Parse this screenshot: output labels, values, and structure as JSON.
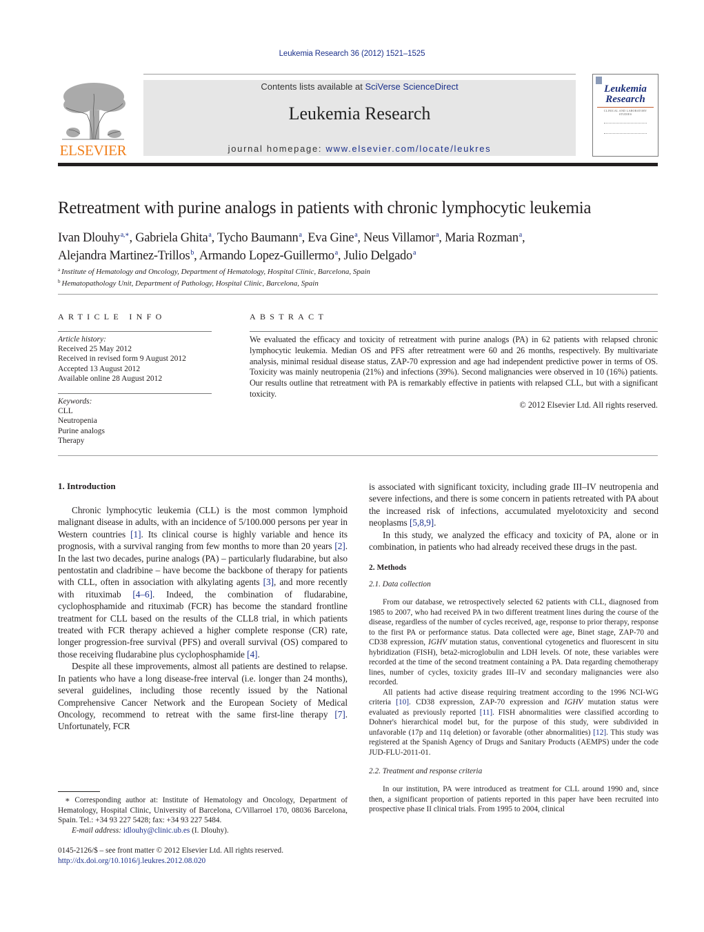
{
  "citation": "Leukemia Research 36 (2012) 1521–1525",
  "masthead": {
    "publisher": "ELSEVIER",
    "contents_prefix": "Contents lists available at ",
    "contents_link": "SciVerse ScienceDirect",
    "journal_name": "Leukemia Research",
    "homepage_prefix": "journal homepage: ",
    "homepage_link": "www.elsevier.com/locate/leukres",
    "cover_title_line1": "Leukemia",
    "cover_title_line2": "Research",
    "cover_subtitle": "CLINICAL AND LABORATORY STUDIES",
    "colors": {
      "link": "#1a2f8a",
      "publisher_orange": "#f07f1b",
      "banner_gray": "#e6e6e6"
    }
  },
  "article": {
    "title": "Retreatment with purine analogs in patients with chronic lymphocytic leukemia",
    "authors": [
      {
        "name": "Ivan Dlouhy",
        "aff": "a,∗"
      },
      {
        "name": "Gabriela Ghita",
        "aff": "a"
      },
      {
        "name": "Tycho Baumann",
        "aff": "a"
      },
      {
        "name": "Eva Gine",
        "aff": "a"
      },
      {
        "name": "Neus Villamor",
        "aff": "a"
      },
      {
        "name": "Maria Rozman",
        "aff": "a"
      },
      {
        "name": "Alejandra Martinez-Trillos",
        "aff": "b"
      },
      {
        "name": "Armando Lopez-Guillermo",
        "aff": "a"
      },
      {
        "name": "Julio Delgado",
        "aff": "a"
      }
    ],
    "affiliations": [
      {
        "mark": "a",
        "text": "Institute of Hematology and Oncology, Department of Hematology, Hospital Clinic, Barcelona, Spain"
      },
      {
        "mark": "b",
        "text": "Hematopathology Unit, Department of Pathology, Hospital Clinic, Barcelona, Spain"
      }
    ]
  },
  "article_info": {
    "heading": "ARTICLE INFO",
    "history_label": "Article history:",
    "history": [
      "Received 25 May 2012",
      "Received in revised form 9 August 2012",
      "Accepted 13 August 2012",
      "Available online 28 August 2012"
    ],
    "keywords_label": "Keywords:",
    "keywords": [
      "CLL",
      "Neutropenia",
      "Purine analogs",
      "Therapy"
    ]
  },
  "abstract": {
    "heading": "ABSTRACT",
    "text": "We evaluated the efficacy and toxicity of retreatment with purine analogs (PA) in 62 patients with relapsed chronic lymphocytic leukemia. Median OS and PFS after retreatment were 60 and 26 months, respectively. By multivariate analysis, minimal residual disease status, ZAP-70 expression and age had independent predictive power in terms of OS. Toxicity was mainly neutropenia (21%) and infections (39%). Second malignancies were observed in 10 (16%) patients. Our results outline that retreatment with PA is remarkably effective in patients with relapsed CLL, but with a significant toxicity.",
    "copyright": "© 2012 Elsevier Ltd. All rights reserved."
  },
  "intro": {
    "heading": "1.  Introduction",
    "p1": [
      {
        "t": "Chronic lymphocytic leukemia (CLL) is the most common lymphoid malignant disease in adults, with an incidence of 5/100.000 persons per year in Western countries "
      },
      {
        "r": "[1]"
      },
      {
        "t": ". Its clinical course is highly variable and hence its prognosis, with a survival ranging from few months to more than 20 years "
      },
      {
        "r": "[2]"
      },
      {
        "t": ". In the last two decades, purine analogs (PA) – particularly fludarabine, but also pentostatin and cladribine – have become the backbone of therapy for patients with CLL, often in association with alkylating agents "
      },
      {
        "r": "[3]"
      },
      {
        "t": ", and more recently with rituximab "
      },
      {
        "r": "[4–6]"
      },
      {
        "t": ". Indeed, the combination of fludarabine, cyclophosphamide and rituximab (FCR) has become the standard frontline treatment for CLL based on the results of the CLL8 trial, in which patients treated with FCR therapy achieved a higher complete response (CR) rate, longer progression-free survival (PFS) and overall survival (OS) compared to those receiving fludarabine plus cyclophosphamide "
      },
      {
        "r": "[4]"
      },
      {
        "t": "."
      }
    ],
    "p2": [
      {
        "t": "Despite all these improvements, almost all patients are destined to relapse. In patients who have a long disease-free interval (i.e. longer than 24 months), several guidelines, including those recently issued by the National Comprehensive Cancer Network and the European Society of Medical Oncology, recommend to retreat with the same first-line therapy "
      },
      {
        "r": "[7]"
      },
      {
        "t": ". Unfortunately, FCR"
      }
    ],
    "p2_cont": [
      {
        "t": "is associated with significant toxicity, including grade III–IV neutropenia and severe infections, and there is some concern in patients retreated with PA about the increased risk of infections, accumulated myelotoxicity and second neoplasms "
      },
      {
        "r": "[5,8,9]"
      },
      {
        "t": "."
      }
    ],
    "p3": [
      {
        "t": "In this study, we analyzed the efficacy and toxicity of PA, alone or in combination, in patients who had already received these drugs in the past."
      }
    ]
  },
  "methods": {
    "heading": "2.  Methods",
    "sub1": "2.1.   Data collection",
    "sub1_p1": [
      {
        "t": "From our database, we retrospectively selected 62 patients with CLL, diagnosed from 1985 to 2007, who had received PA in two different treatment lines during the course of the disease, regardless of the number of cycles received, age, response to prior therapy, response to the first PA or performance status. Data collected were age, Binet stage, ZAP-70 and CD38 expression, "
      },
      {
        "i": "IGHV"
      },
      {
        "t": " mutation status, conventional cytogenetics and fluorescent in situ hybridization (FISH), beta2-microglobulin and LDH levels. Of note, these variables were recorded at the time of the second treatment containing a PA. Data regarding chemotherapy lines, number of cycles, toxicity grades III–IV and secondary malignancies were also recorded."
      }
    ],
    "sub1_p2": [
      {
        "t": "All patients had active disease requiring treatment according to the 1996 NCI-WG criteria "
      },
      {
        "r": "[10]"
      },
      {
        "t": ". CD38 expression, ZAP-70 expression and "
      },
      {
        "i": "IGHV"
      },
      {
        "t": " mutation status were evaluated as previously reported "
      },
      {
        "r": "[11]"
      },
      {
        "t": ". FISH abnormalities were classified according to Dohner's hierarchical model but, for the purpose of this study, were subdivided in unfavorable (17p and 11q deletion) or favorable (other abnormalities) "
      },
      {
        "r": "[12]"
      },
      {
        "t": ". This study was registered at the Spanish Agency of Drugs and Sanitary Products (AEMPS) under the code JUD-FLU-2011-01."
      }
    ],
    "sub2": "2.2.   Treatment and response criteria",
    "sub2_p1": [
      {
        "t": "In our institution, PA were introduced as treatment for CLL around 1990 and, since then, a significant proportion of patients reported in this paper have been recruited into prospective phase II clinical trials. From 1995 to 2004, clinical"
      }
    ]
  },
  "footnote": {
    "corresponding": "∗  Corresponding author at: Institute of Hematology and Oncology, Department of Hematology, Hospital Clinic, University of Barcelona, C/Villarroel 170, 08036 Barcelona, Spain. Tel.: +34 93 227 5428; fax: +34 93 227 5484.",
    "email_label": "E-mail address:",
    "email": "idlouhy@clinic.ub.es",
    "email_suffix": " (I. Dlouhy).",
    "front_matter": "0145-2126/$ – see front matter © 2012 Elsevier Ltd. All rights reserved.",
    "doi": "http://dx.doi.org/10.1016/j.leukres.2012.08.020"
  }
}
